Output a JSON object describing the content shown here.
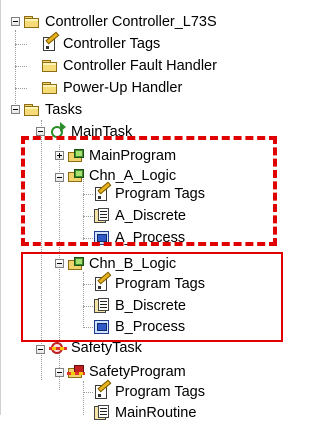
{
  "tree": {
    "controller": {
      "label": "Controller Controller_L73S",
      "icon": "folder-icon"
    },
    "controller_tags": {
      "label": "Controller Tags",
      "icon": "tags-icon"
    },
    "controller_fault_handler": {
      "label": "Controller Fault Handler",
      "icon": "folder-icon"
    },
    "power_up_handler": {
      "label": "Power-Up Handler",
      "icon": "folder-icon"
    },
    "tasks": {
      "label": "Tasks",
      "icon": "folder-icon"
    },
    "main_task": {
      "label": "MainTask",
      "icon": "continuous-task-icon"
    },
    "main_program": {
      "label": "MainProgram",
      "icon": "program-icon"
    },
    "chn_a_logic": {
      "label": "Chn_A_Logic",
      "icon": "program-icon"
    },
    "chn_a_program_tags": {
      "label": "Program Tags",
      "icon": "tags-icon"
    },
    "a_discrete": {
      "label": "A_Discrete",
      "icon": "ladder-routine-icon"
    },
    "a_process": {
      "label": "A_Process",
      "icon": "function-block-routine-icon"
    },
    "chn_b_logic": {
      "label": "Chn_B_Logic",
      "icon": "program-icon"
    },
    "chn_b_program_tags": {
      "label": "Program Tags",
      "icon": "tags-icon"
    },
    "b_discrete": {
      "label": "B_Discrete",
      "icon": "ladder-routine-icon"
    },
    "b_process": {
      "label": "B_Process",
      "icon": "function-block-routine-icon"
    },
    "safety_task": {
      "label": "SafetyTask",
      "icon": "safety-task-icon"
    },
    "safety_program": {
      "label": "SafetyProgram",
      "icon": "safety-program-icon"
    },
    "safety_program_tags": {
      "label": "Program Tags",
      "icon": "tags-icon"
    },
    "main_routine": {
      "label": "MainRoutine",
      "icon": "ladder-routine-icon"
    }
  },
  "colors": {
    "highlight": "#e00000",
    "folder": "#f6dc78",
    "guide_lines": "#9a9a9a"
  }
}
